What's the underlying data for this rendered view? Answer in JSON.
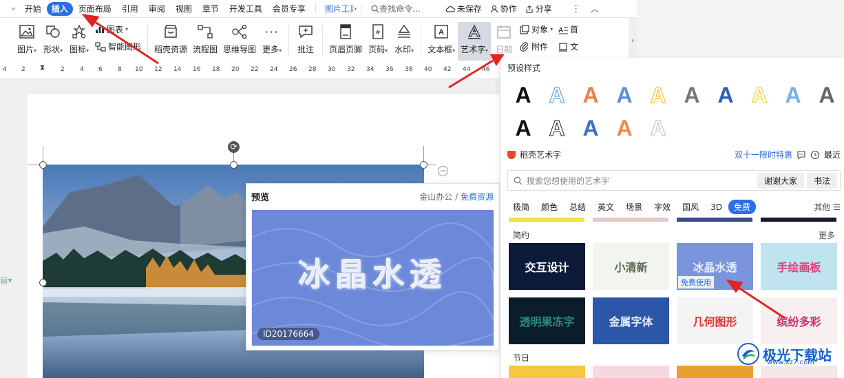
{
  "menubar": {
    "overflow": "»",
    "tabs": [
      "开始",
      "插入",
      "页面布局",
      "引用",
      "审阅",
      "视图",
      "章节",
      "开发工具",
      "会员专享",
      "图片工具"
    ],
    "active_tab": "插入",
    "search": "查找命令...",
    "unsaved": "未保存",
    "collab": "协作",
    "share": "分享"
  },
  "ribbon": {
    "picture": "图片",
    "shape": "形状",
    "icon": "图标",
    "chart": "图表",
    "smart_graphic": "智能图形",
    "daoke": "稻壳资源",
    "flowchart": "流程图",
    "mindmap": "思维导图",
    "more": "更多",
    "comment": "批注",
    "header_footer": "页眉页脚",
    "page_number": "页码",
    "watermark": "水印",
    "textbox": "文本框",
    "arttext": "艺术字",
    "date": "日期",
    "object": "对象",
    "attachment": "附件",
    "first": "首",
    "wen": "文"
  },
  "ruler": {
    "labels": [
      "4",
      "2",
      "2",
      "4",
      "6",
      "8",
      "10",
      "12",
      "14",
      "16",
      "18",
      "20",
      "22",
      "24",
      "26",
      "28",
      "30",
      "32",
      "34",
      "36",
      "38",
      "40",
      "42",
      "44",
      "46"
    ]
  },
  "preview": {
    "title": "预览",
    "source": "金山办公",
    "divider": "/",
    "free": "免费资源",
    "art_text": "冰晶水透",
    "id": "ID20176664"
  },
  "panel": {
    "preset_title": "预设样式",
    "presets_row1_colors": [
      "#111111",
      "#4a90d9",
      "#e8824a",
      "#5a8fd8",
      "#f1b800",
      "#777777",
      "#2c5fb8",
      "#f0c828",
      "#7ab0e8",
      "#666666"
    ],
    "presets_row2_colors": [
      "#111111",
      "#222222",
      "#3a6fc8",
      "#f08a4a",
      "#bbbbbb"
    ],
    "preset_glyph": "A",
    "brand": "稻壳艺术字",
    "promo": "双十一限时特惠",
    "recent": "最近",
    "search_placeholder": "搜索您想使用的艺术字",
    "chip1": "谢谢大家",
    "chip2": "书法",
    "categories": [
      "极简",
      "颜色",
      "总结",
      "英文",
      "场景",
      "字效",
      "国风",
      "3D",
      "免费"
    ],
    "active_category": "免费",
    "other": "其他",
    "section_simple": "简约",
    "more": "更多",
    "section_holiday": "节日",
    "free_tag": "免费使用",
    "thumbs": [
      {
        "text": "交互设计",
        "bg": "#0d1a3a",
        "fg": "#ffffff"
      },
      {
        "text": "小清新",
        "bg": "#f2f4ef",
        "fg": "#5b6b55"
      },
      {
        "text": "冰晶水透",
        "bg": "#7b95dc",
        "fg": "#e6ecfa"
      },
      {
        "text": "手绘画板",
        "bg": "#bfe3ef",
        "fg": "#e0407a"
      },
      {
        "text": "透明果冻字",
        "bg": "#0b1d2a",
        "fg": "#2f8a7a"
      },
      {
        "text": "金属字体",
        "bg": "#2c56a8",
        "fg": "#e8eef8"
      },
      {
        "text": "几何图形",
        "bg": "#f4f4f4",
        "fg": "#e03030"
      },
      {
        "text": "缤纷多彩",
        "bg": "#f7eef0",
        "fg": "#d02a6a"
      }
    ]
  },
  "watermark": {
    "text": "极光下载站",
    "sub": "www.xz7.com",
    "side": "更多"
  },
  "colors": {
    "accent": "#2b6fe6",
    "arrow": "#e02424"
  }
}
